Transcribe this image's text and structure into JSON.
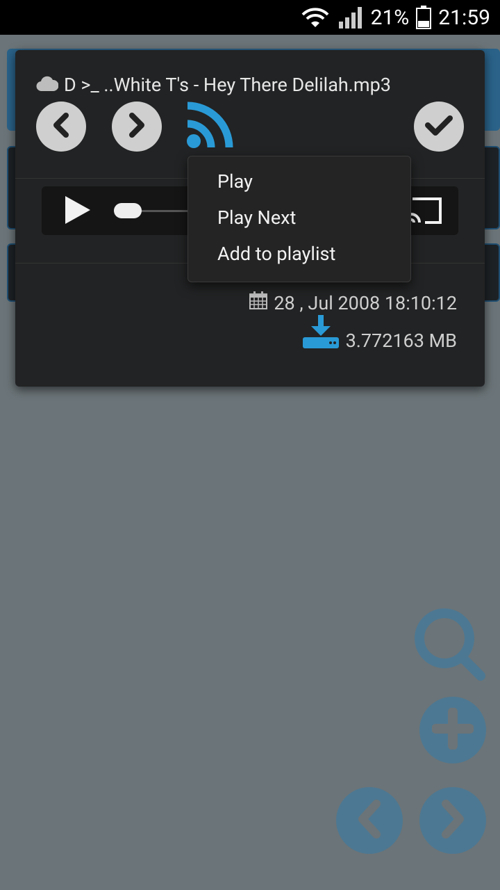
{
  "status_bar": {
    "battery_percent": "21%",
    "time": "21:59"
  },
  "dialog": {
    "title_prefix": "D >_ ..White T's - Hey There Delilah.mp3",
    "date": "28 , Jul 2008 18:10:12",
    "size": "3.772163 MB"
  },
  "menu": {
    "items": [
      {
        "label": "Play"
      },
      {
        "label": "Play Next"
      },
      {
        "label": "Add to playlist"
      }
    ]
  },
  "colors": {
    "accent": "#2a9ad6",
    "fab": "#4d7893",
    "dialog_bg": "#222324"
  },
  "icons": [
    "wifi-icon",
    "signal-icon",
    "battery-icon",
    "cloud-icon",
    "prev-icon",
    "next-icon",
    "rss-icon",
    "check-icon",
    "play-icon",
    "cast-icon",
    "calendar-icon",
    "download-icon",
    "search-icon",
    "add-icon",
    "chevron-left-icon",
    "chevron-right-icon"
  ]
}
